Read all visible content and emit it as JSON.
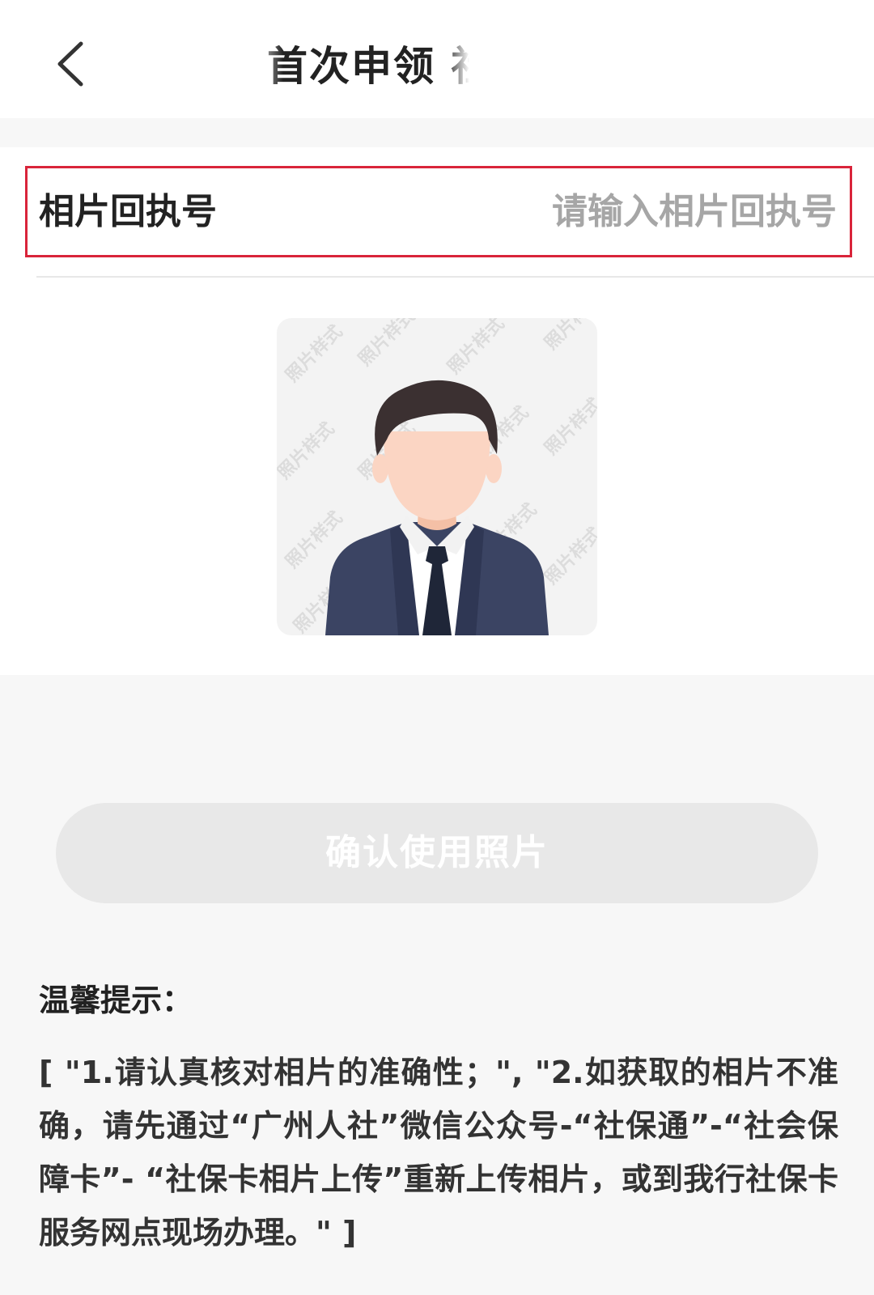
{
  "header": {
    "back_icon": "chevron-left-icon",
    "title": "首次申领      社"
  },
  "form": {
    "receipt_label": "相片回执号",
    "receipt_placeholder": "请输入相片回执号",
    "receipt_value": ""
  },
  "photo": {
    "watermark": "照片样式",
    "colors": {
      "hair": "#3b3031",
      "skin": "#fbd5c3",
      "suit": "#3b4463",
      "tie": "#1f2638",
      "shirt": "#ffffff",
      "highlight": "#d9243a"
    }
  },
  "actions": {
    "confirm_label": "确认使用照片"
  },
  "tips": {
    "title": "温馨提示：",
    "body": "[ \"1.请认真核对相片的准确性；\", \"2.如获取的相片不准确，请先通过“广州人社”微信公众号-“社保通”-“社会保障卡”- “社保卡相片上传”重新上传相片，或到我行社保卡服务网点现场办理。\" ]"
  }
}
